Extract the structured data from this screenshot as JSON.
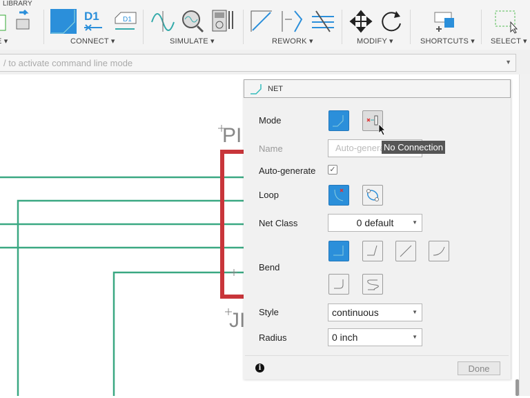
{
  "toolbar": {
    "library_label": "LIBRARY",
    "groups": [
      {
        "label": "E ▾"
      },
      {
        "label": "CONNECT ▾"
      },
      {
        "label": "SIMULATE ▾"
      },
      {
        "label": "REWORK ▾"
      },
      {
        "label": "MODIFY ▾"
      },
      {
        "label": "SHORTCUTS ▾"
      },
      {
        "label": "SELECT ▾"
      }
    ],
    "net_icon_text": "D1"
  },
  "command_line": {
    "placeholder": "/ to activate command line mode"
  },
  "canvas": {
    "labels": [
      "PI",
      "JI"
    ]
  },
  "net_panel": {
    "title": "NET",
    "mode_label": "Mode",
    "name_label": "Name",
    "name_placeholder": "Auto-generate",
    "tooltip": "No Connection",
    "autogen_label": "Auto-generate",
    "autogen_checked": true,
    "loop_label": "Loop",
    "netclass_label": "Net Class",
    "netclass_value": "0 default",
    "bend_label": "Bend",
    "style_label": "Style",
    "style_value": "continuous",
    "radius_label": "Radius",
    "radius_value": "0 inch",
    "done_label": "Done"
  },
  "colors": {
    "accent": "#2b8fda",
    "wire": "#3aa882",
    "frame": "#c8353a"
  }
}
